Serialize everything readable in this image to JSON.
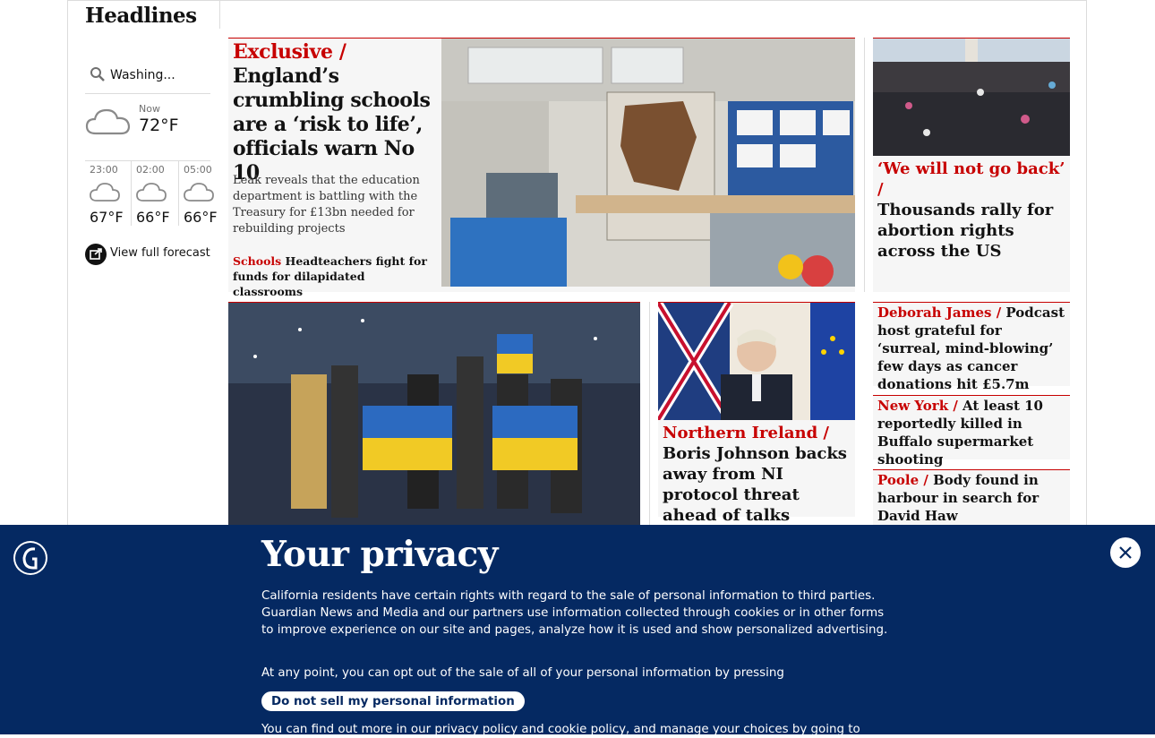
{
  "section": {
    "title": "Headlines"
  },
  "weather": {
    "location": "Washing...",
    "now_label": "Now",
    "now_temp": "72°F",
    "forecast": [
      {
        "time": "23:00",
        "temp": "67°F"
      },
      {
        "time": "02:00",
        "temp": "66°F"
      },
      {
        "time": "05:00",
        "temp": "66°F"
      }
    ],
    "view_full": "View full forecast"
  },
  "main_story": {
    "kicker": "Exclusive /",
    "headline": "England’s crumbling schools are a ‘risk to life’, officials warn No 10",
    "standfirst": "Leak reveals that the education department is battling with the Treasury for £13bn needed for rebuilding projects",
    "sublink_kicker": "Schools",
    "sublink_text": "Headteachers fight for funds for dilapidated classrooms"
  },
  "side_story": {
    "kicker": "‘We will not go back’ /",
    "headline": "Thousands rally for abortion rights across the US"
  },
  "ni_story": {
    "kicker": "Northern Ireland /",
    "headline": "Boris Johnson backs away from NI protocol threat ahead of talks"
  },
  "small_stories": [
    {
      "kicker": "Deborah James /",
      "headline": "Podcast host grateful for ‘surreal, mind-blowing’ few days as cancer donations hit £5.7m"
    },
    {
      "kicker": "New York /",
      "headline": "At least 10 reportedly killed in Buffalo supermarket shooting"
    },
    {
      "kicker": "Poole /",
      "headline": "Body found in harbour in search for David Haw"
    }
  ],
  "privacy": {
    "title": "Your privacy",
    "p1": "California residents have certain rights with regard to the sale of personal information to third parties. Guardian News and Media and our partners use information collected through cookies or in other forms to improve experience on our site and pages, analyze how it is used and show personalized advertising.",
    "p2": "At any point, you can opt out of the sale of all of your personal information by pressing",
    "button": "Do not sell my personal information",
    "p3": "You can find out more in our privacy policy and cookie policy, and manage your choices by going to"
  },
  "colors": {
    "brand": "#052962",
    "accent": "#c70000",
    "card_bg": "#f6f6f6"
  }
}
